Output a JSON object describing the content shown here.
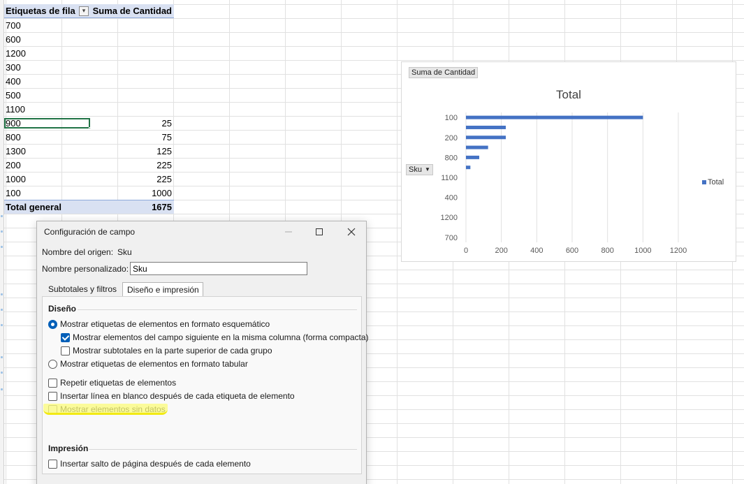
{
  "pivot": {
    "header": {
      "row_labels": "Etiquetas de fila",
      "sum_label": "Suma de Cantidad"
    },
    "rows": [
      {
        "label": "700",
        "value": ""
      },
      {
        "label": "600",
        "value": ""
      },
      {
        "label": "1200",
        "value": ""
      },
      {
        "label": "300",
        "value": ""
      },
      {
        "label": "400",
        "value": ""
      },
      {
        "label": "500",
        "value": ""
      },
      {
        "label": "1100",
        "value": ""
      },
      {
        "label": "900",
        "value": "25"
      },
      {
        "label": "800",
        "value": "75"
      },
      {
        "label": "1300",
        "value": "125"
      },
      {
        "label": "200",
        "value": "225"
      },
      {
        "label": "1000",
        "value": "225"
      },
      {
        "label": "100",
        "value": "1000"
      }
    ],
    "total": {
      "label": "Total general",
      "value": "1675"
    }
  },
  "chart": {
    "field_button": "Suma de Cantidad",
    "axis_button": "Sku",
    "legend": "Total"
  },
  "chart_data": {
    "type": "bar",
    "orientation": "horizontal",
    "title": "Total",
    "categories_top_to_bottom": [
      "100",
      "",
      "200",
      "",
      "800",
      "",
      "1100",
      "",
      "400",
      "",
      "1200",
      "",
      "700"
    ],
    "tick_labels": [
      "100",
      "200",
      "800",
      "1100",
      "400",
      "1200",
      "700"
    ],
    "series": [
      {
        "name": "Total",
        "values": [
          1000,
          225,
          225,
          125,
          75,
          25,
          0,
          0,
          0,
          0,
          0,
          0,
          0
        ]
      }
    ],
    "xlim": [
      0,
      1200
    ],
    "xticks": [
      0,
      200,
      400,
      600,
      800,
      1000,
      1200
    ],
    "grid": "vertical",
    "legend_position": "right",
    "color": "#4472c4"
  },
  "dialog": {
    "title": "Configuración de campo",
    "source_name_label": "Nombre del origen:",
    "source_name_value": "Sku",
    "custom_name_label": "Nombre personalizado:",
    "custom_name_value": "Sku",
    "tabs": [
      {
        "label": "Subtotales y filtros",
        "active": false
      },
      {
        "label": "Diseño e impresión",
        "active": true
      }
    ],
    "layout": {
      "title": "Diseño",
      "options": [
        {
          "type": "radio",
          "label": "Mostrar etiquetas de elementos en formato esquemático",
          "checked": true
        },
        {
          "type": "checkbox",
          "label": "Mostrar elementos del campo siguiente en la misma columna (forma compacta)",
          "checked": true
        },
        {
          "type": "checkbox",
          "label": "Mostrar subtotales en la parte superior de cada grupo",
          "checked": false
        },
        {
          "type": "radio",
          "label": "Mostrar etiquetas de elementos en formato tabular",
          "checked": false
        },
        {
          "type": "checkbox",
          "label": "Repetir etiquetas de elementos",
          "checked": false
        },
        {
          "type": "checkbox",
          "label": "Insertar línea en blanco después de cada etiqueta de elemento",
          "checked": false
        },
        {
          "type": "checkbox",
          "label": "Mostrar elementos sin datos",
          "checked": false,
          "disabled": true
        }
      ]
    },
    "print": {
      "title": "Impresión",
      "options": [
        {
          "type": "checkbox",
          "label": "Insertar salto de página después de cada elemento",
          "checked": false
        }
      ]
    }
  },
  "colors": {
    "accent": "#005fb8",
    "pivot_header": "#d9e1f2",
    "selection": "#217346",
    "highlight": "#ffff00"
  }
}
